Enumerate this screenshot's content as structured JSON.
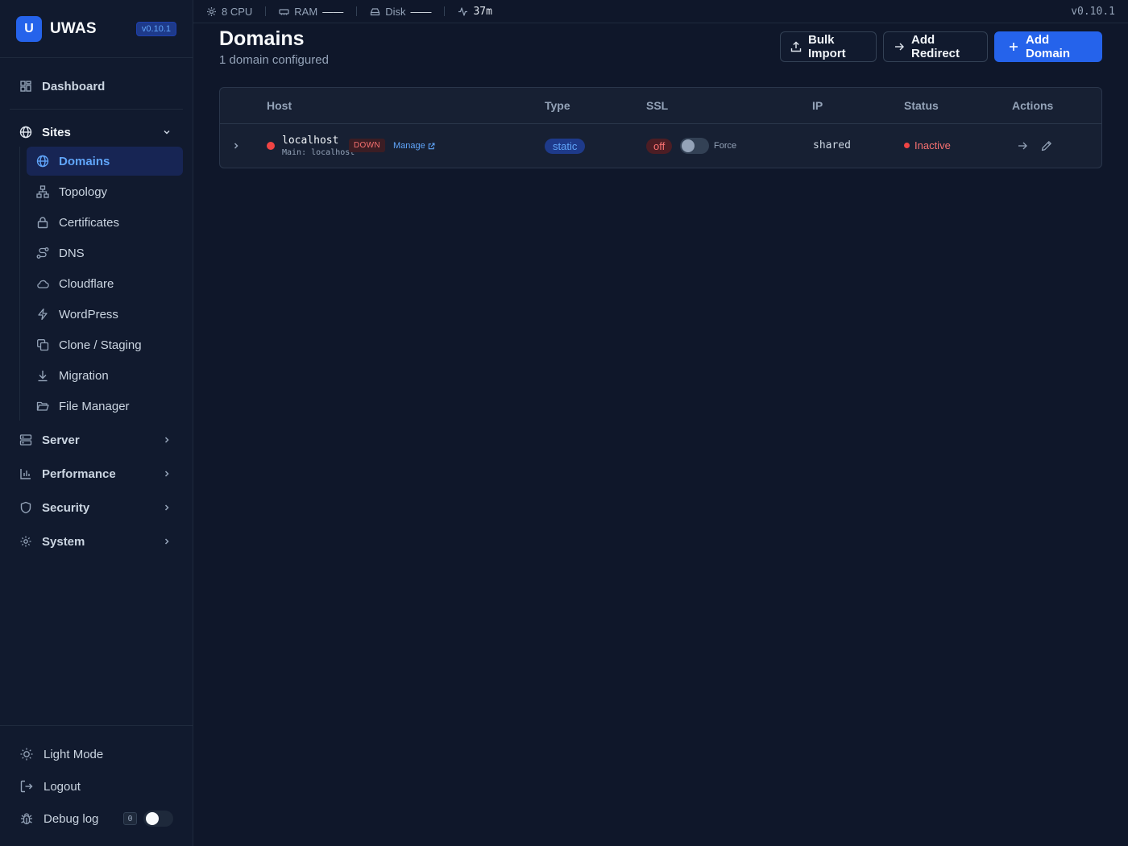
{
  "brand": {
    "logo_letter": "U",
    "name": "UWAS",
    "version": "v0.10.1"
  },
  "sidebar": {
    "dashboard": "Dashboard",
    "sites": "Sites",
    "sites_items": [
      "Domains",
      "Topology",
      "Certificates",
      "DNS",
      "Cloudflare",
      "WordPress",
      "Clone / Staging",
      "Migration",
      "File Manager"
    ],
    "server": "Server",
    "performance": "Performance",
    "security": "Security",
    "system": "System",
    "footer": {
      "light_mode": "Light Mode",
      "logout": "Logout",
      "debug_log": "Debug log",
      "debug_count": "0"
    }
  },
  "topbar": {
    "cpu": "8 CPU",
    "ram_label": "RAM",
    "ram_value": "——",
    "disk_label": "Disk",
    "disk_value": "——",
    "uptime": "37m",
    "version": "v0.10.1"
  },
  "page": {
    "title": "Domains",
    "subtitle": "1 domain configured"
  },
  "buttons": {
    "bulk_import": "Bulk Import",
    "add_redirect": "Add Redirect",
    "add_domain": "Add Domain"
  },
  "table": {
    "headers": [
      "Host",
      "Type",
      "SSL",
      "IP",
      "Status",
      "Actions"
    ],
    "rows": [
      {
        "host": "localhost",
        "main": "Main: localhost",
        "health": "DOWN",
        "manage": "Manage",
        "type": "static",
        "ssl": "off",
        "force": "Force",
        "ip": "shared",
        "status": "Inactive"
      }
    ]
  },
  "colors": {
    "accent": "#2563eb",
    "danger": "#ef4444",
    "link": "#60a5fa",
    "background": "#0f172a"
  }
}
